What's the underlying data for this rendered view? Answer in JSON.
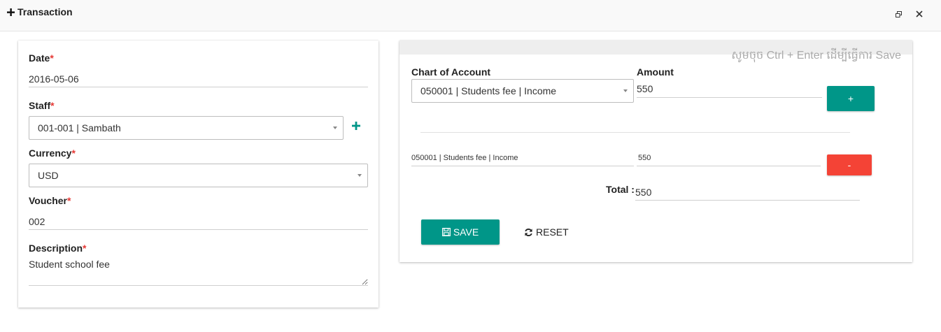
{
  "dialog": {
    "title": "Transaction"
  },
  "form": {
    "date": {
      "label": "Date",
      "required_mark": "*",
      "value": "2016-05-06"
    },
    "staff": {
      "label": "Staff",
      "required_mark": "*",
      "value": "001-001 | Sambath"
    },
    "currency": {
      "label": "Currency",
      "required_mark": "*",
      "value": "USD"
    },
    "voucher": {
      "label": "Voucher",
      "required_mark": "*",
      "value": "002"
    },
    "description": {
      "label": "Description",
      "required_mark": "*",
      "value": "Student school fee"
    }
  },
  "entries": {
    "hint": "សូមចុច Ctrl + Enter ដើម្បីធ្វើការ Save",
    "chart_of_account_label": "Chart of Account",
    "amount_label": "Amount",
    "new_account": "050001 | Students fee | Income",
    "new_amount": "550",
    "add_label": "+",
    "rows": [
      {
        "account": "050001 | Students fee | Income",
        "amount": "550",
        "remove_label": "-"
      }
    ],
    "total_label": "Total :",
    "total_value": "550",
    "save_label": "SAVE",
    "reset_label": "RESET"
  },
  "colors": {
    "primary": "#009688",
    "danger": "#f44336",
    "required": "#e53935"
  },
  "icons": [
    "plus-icon",
    "restore-window-icon",
    "close-icon",
    "add-staff-icon",
    "save-icon",
    "refresh-icon"
  ]
}
